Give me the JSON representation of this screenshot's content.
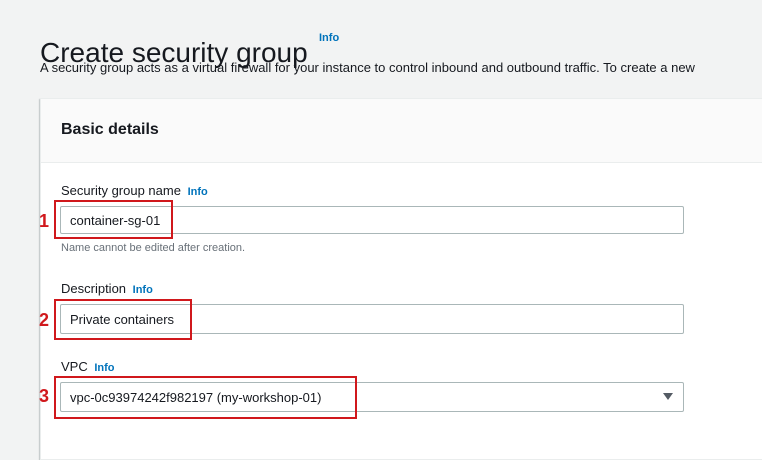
{
  "header": {
    "title": "Create security group",
    "title_info": "Info",
    "description": "A security group acts as a virtual firewall for your instance to control inbound and outbound traffic. To create a new"
  },
  "panel": {
    "title": "Basic details",
    "fields": {
      "name": {
        "label": "Security group name",
        "info": "Info",
        "value": "container-sg-01",
        "hint": "Name cannot be edited after creation."
      },
      "description": {
        "label": "Description",
        "info": "Info",
        "value": "Private containers"
      },
      "vpc": {
        "label": "VPC",
        "info": "Info",
        "value": "vpc-0c93974242f982197 (my-workshop-01)",
        "icon": "caret-down-icon"
      }
    }
  },
  "annotations": [
    "1",
    "2",
    "3"
  ],
  "colors": {
    "accent_link": "#0073bb",
    "annotation": "#d0181c",
    "background": "#f2f3f3"
  }
}
